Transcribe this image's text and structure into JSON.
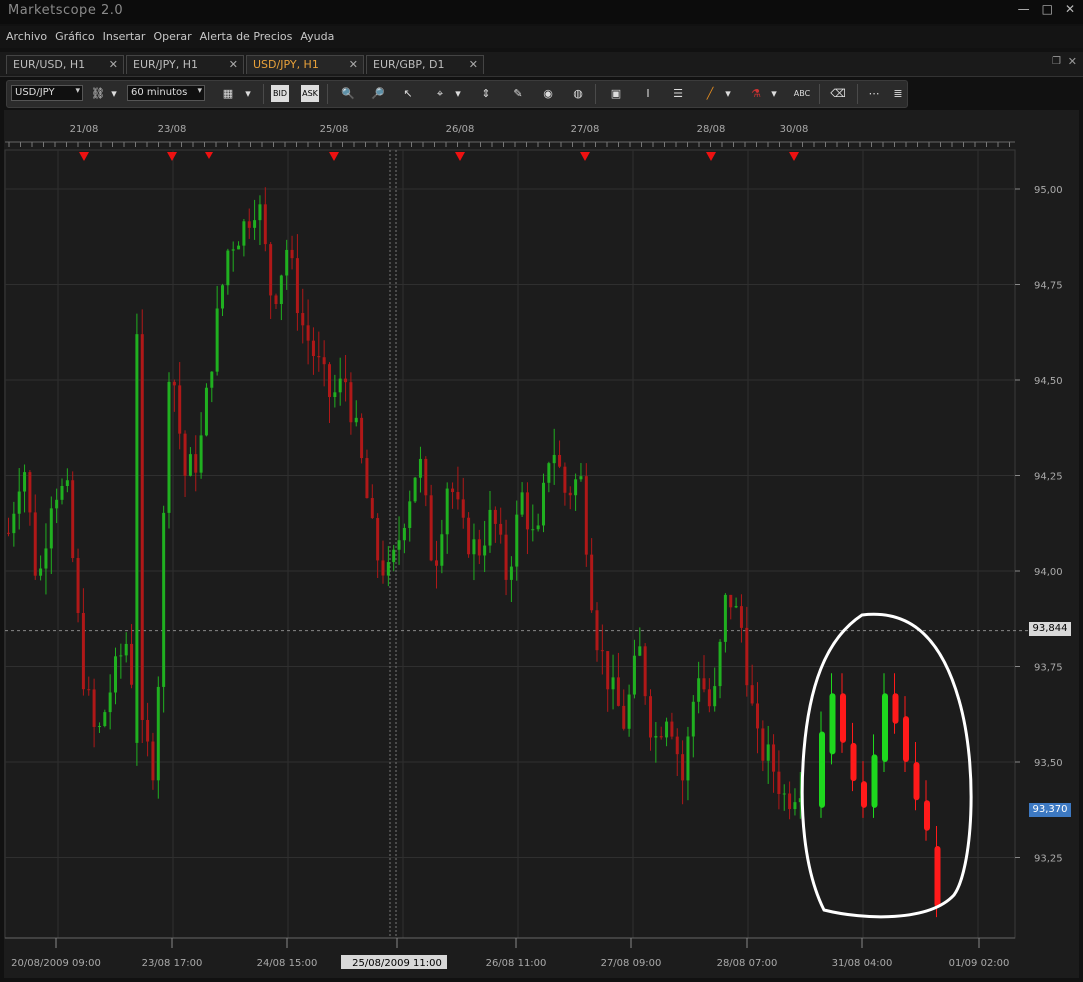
{
  "app": {
    "title": "Marketscope 2.0"
  },
  "window_controls": {
    "minimize": "—",
    "maximize": "□",
    "close": "✕"
  },
  "menu": [
    "Archivo",
    "Gráfico",
    "Insertar",
    "Operar",
    "Alerta de Precios",
    "Ayuda"
  ],
  "tabs": [
    {
      "label": "EUR/USD, H1",
      "active": false
    },
    {
      "label": "EUR/JPY, H1",
      "active": false
    },
    {
      "label": "USD/JPY, H1",
      "active": true
    },
    {
      "label": "EUR/GBP, D1",
      "active": false
    }
  ],
  "toolbar": {
    "instrument": "USD/JPY",
    "timeframe": "60 minutos",
    "icons": [
      "link-icon",
      "chart-type-icon",
      "bid-icon",
      "ask-icon",
      "zoom-in-icon",
      "zoom-out-icon",
      "cursor-icon",
      "crosshair-icon",
      "cursor-line-icon",
      "notes-icon",
      "eye-icon",
      "globe-icon",
      "picture-icon",
      "text-icon",
      "data-window-icon",
      "pencil-icon",
      "indicator-icon",
      "abc-icon",
      "eraser-icon",
      "grid-icon",
      "properties-icon"
    ],
    "labels": {
      "bid": "BID",
      "ask": "ASK",
      "abc": "ABC"
    }
  },
  "chart_data": {
    "type": "candlestick",
    "symbol": "USD/JPY",
    "timeframe": "H1",
    "y_ticks": [
      "95,00",
      "94,75",
      "94,50",
      "94,25",
      "94,00",
      "93,75",
      "93,50",
      "93,25"
    ],
    "y_range": [
      93.05,
      95.1
    ],
    "current_price_label": "93,844",
    "last_price_label": "93,370",
    "current_price": 93.844,
    "last_price": 93.37,
    "top_dates": [
      "21/08",
      "23/08",
      "25/08",
      "26/08",
      "27/08",
      "28/08",
      "30/08"
    ],
    "bottom_dates": [
      "20/08/2009 09:00",
      "23/08 17:00",
      "24/08 15:00",
      "25/08/2009 11:00",
      "26/08 11:00",
      "27/08 09:00",
      "28/08 07:00",
      "31/08 04:00",
      "01/09 02:00"
    ],
    "highlighted_bottom_date": "25/08/2009 11:00",
    "colors": {
      "up": "#20b020",
      "down": "#b01818",
      "bg": "#1c1c1c",
      "grid": "#2f2f2f",
      "drawing_up": "#1ed81e",
      "drawing_down": "#ff1a1a",
      "annotation": "#ffffff",
      "marker": "#ee1111"
    },
    "close_path": [
      94.1,
      94.3,
      93.95,
      94.22,
      94.2,
      93.75,
      93.55,
      93.7,
      93.82,
      93.58,
      93.48,
      94.6,
      94.25,
      94.3,
      94.6,
      94.85,
      94.9,
      94.98,
      94.7,
      94.85,
      94.65,
      94.55,
      94.45,
      94.5,
      94.3,
      94.05,
      93.98,
      94.15,
      94.3,
      94.0,
      94.25,
      94.1,
      94.05,
      94.15,
      93.98,
      94.2,
      94.05,
      94.35,
      94.2,
      94.25,
      93.85,
      93.7,
      93.6,
      93.8,
      93.55,
      93.65,
      93.45,
      93.75,
      93.62,
      93.95,
      93.85,
      93.55,
      93.5,
      93.4,
      93.45
    ],
    "drawn_candles": [
      {
        "dir": "up",
        "open": 93.38,
        "close": 93.58
      },
      {
        "dir": "up",
        "open": 93.52,
        "close": 93.68
      },
      {
        "dir": "down",
        "open": 93.68,
        "close": 93.55
      },
      {
        "dir": "down",
        "open": 93.55,
        "close": 93.45
      },
      {
        "dir": "down",
        "open": 93.45,
        "close": 93.38
      },
      {
        "dir": "up",
        "open": 93.38,
        "close": 93.52
      },
      {
        "dir": "up",
        "open": 93.5,
        "close": 93.68
      },
      {
        "dir": "down",
        "open": 93.68,
        "close": 93.6
      },
      {
        "dir": "down",
        "open": 93.62,
        "close": 93.5
      },
      {
        "dir": "down",
        "open": 93.5,
        "close": 93.4
      },
      {
        "dir": "down",
        "open": 93.4,
        "close": 93.32
      },
      {
        "dir": "down",
        "open": 93.28,
        "close": 93.12
      }
    ]
  }
}
